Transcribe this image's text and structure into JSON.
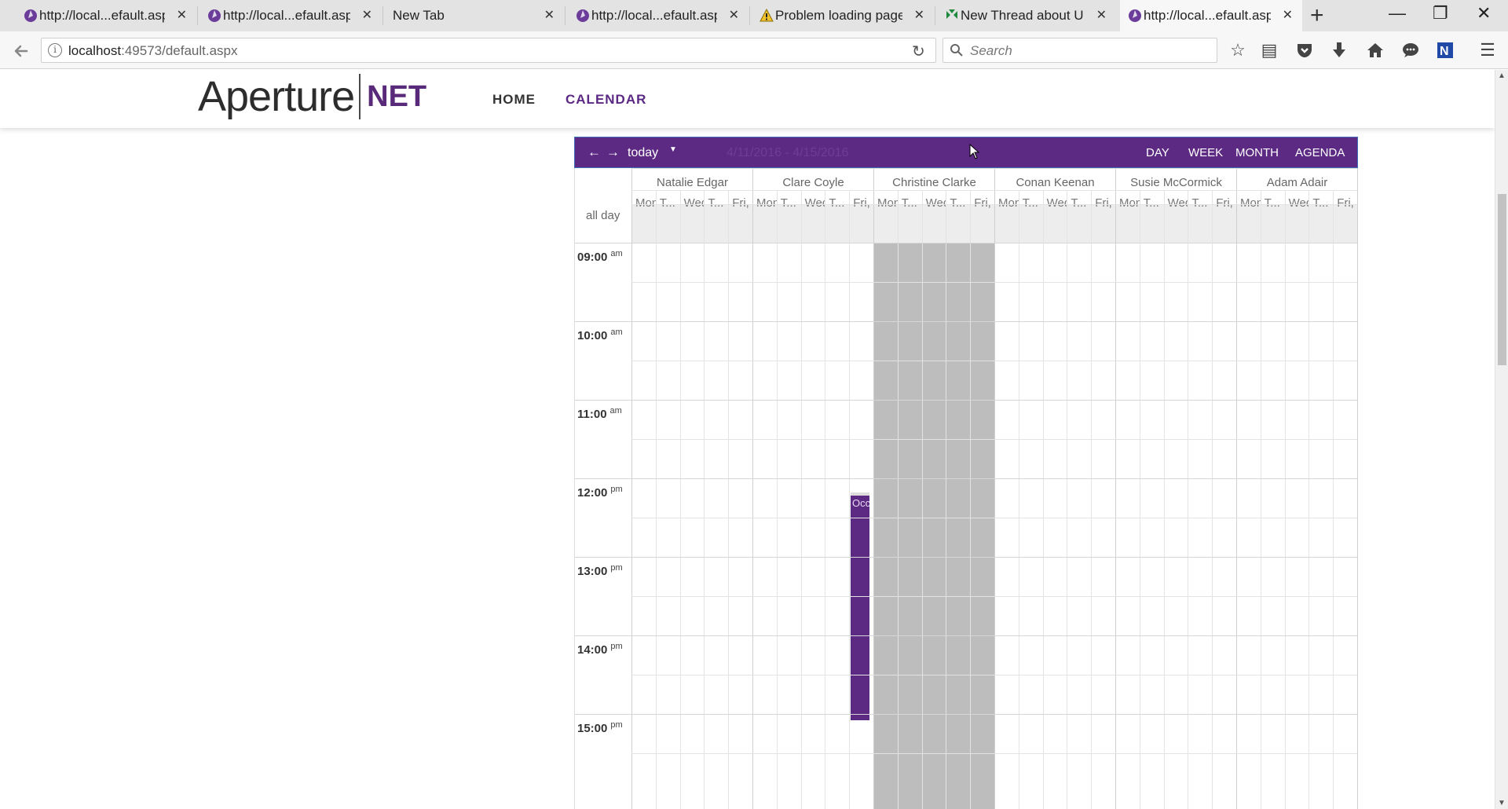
{
  "browser": {
    "tabs": [
      {
        "title": "http://local...efault.aspx",
        "icon": "aperture-icon",
        "active": false
      },
      {
        "title": "http://local...efault.aspx",
        "icon": "aperture-icon",
        "active": false
      },
      {
        "title": "New Tab",
        "icon": "none",
        "active": false
      },
      {
        "title": "http://local...efault.aspx",
        "icon": "aperture-icon",
        "active": false
      },
      {
        "title": "Problem loading page",
        "icon": "warning-icon",
        "active": false
      },
      {
        "title": "New Thread about UI ...",
        "icon": "forum-icon",
        "active": false
      },
      {
        "title": "http://local...efault.aspx",
        "icon": "aperture-icon",
        "active": true
      }
    ],
    "url_host": "localhost",
    "url_path": ":49573/default.aspx",
    "search_placeholder": "Search"
  },
  "site": {
    "logo_main": "Aperture",
    "logo_suffix": "NET",
    "nav": {
      "home": "HOME",
      "calendar": "CALENDAR"
    },
    "accent_color": "#5c2983"
  },
  "calendar": {
    "today_label": "today",
    "date_range": "4/11/2016 - 4/15/2016",
    "views": [
      "DAY",
      "WEEK",
      "MONTH",
      "AGENDA"
    ],
    "resources": [
      "Natalie Edgar",
      "Clare Coyle",
      "Christine Clarke",
      "Conan Keenan",
      "Susie McCormick",
      "Adam Adair"
    ],
    "days": [
      "Mon",
      "T...",
      "Wed",
      "T...",
      "Fri,"
    ],
    "allday_label": "all day",
    "hours": [
      {
        "time": "09:00",
        "ampm": "am"
      },
      {
        "time": "10:00",
        "ampm": "am"
      },
      {
        "time": "11:00",
        "ampm": "am"
      },
      {
        "time": "12:00",
        "ampm": "pm"
      },
      {
        "time": "13:00",
        "ampm": "pm"
      },
      {
        "time": "14:00",
        "ampm": "pm"
      },
      {
        "time": "15:00",
        "ampm": "pm"
      }
    ],
    "event": {
      "label": "Occ"
    }
  }
}
